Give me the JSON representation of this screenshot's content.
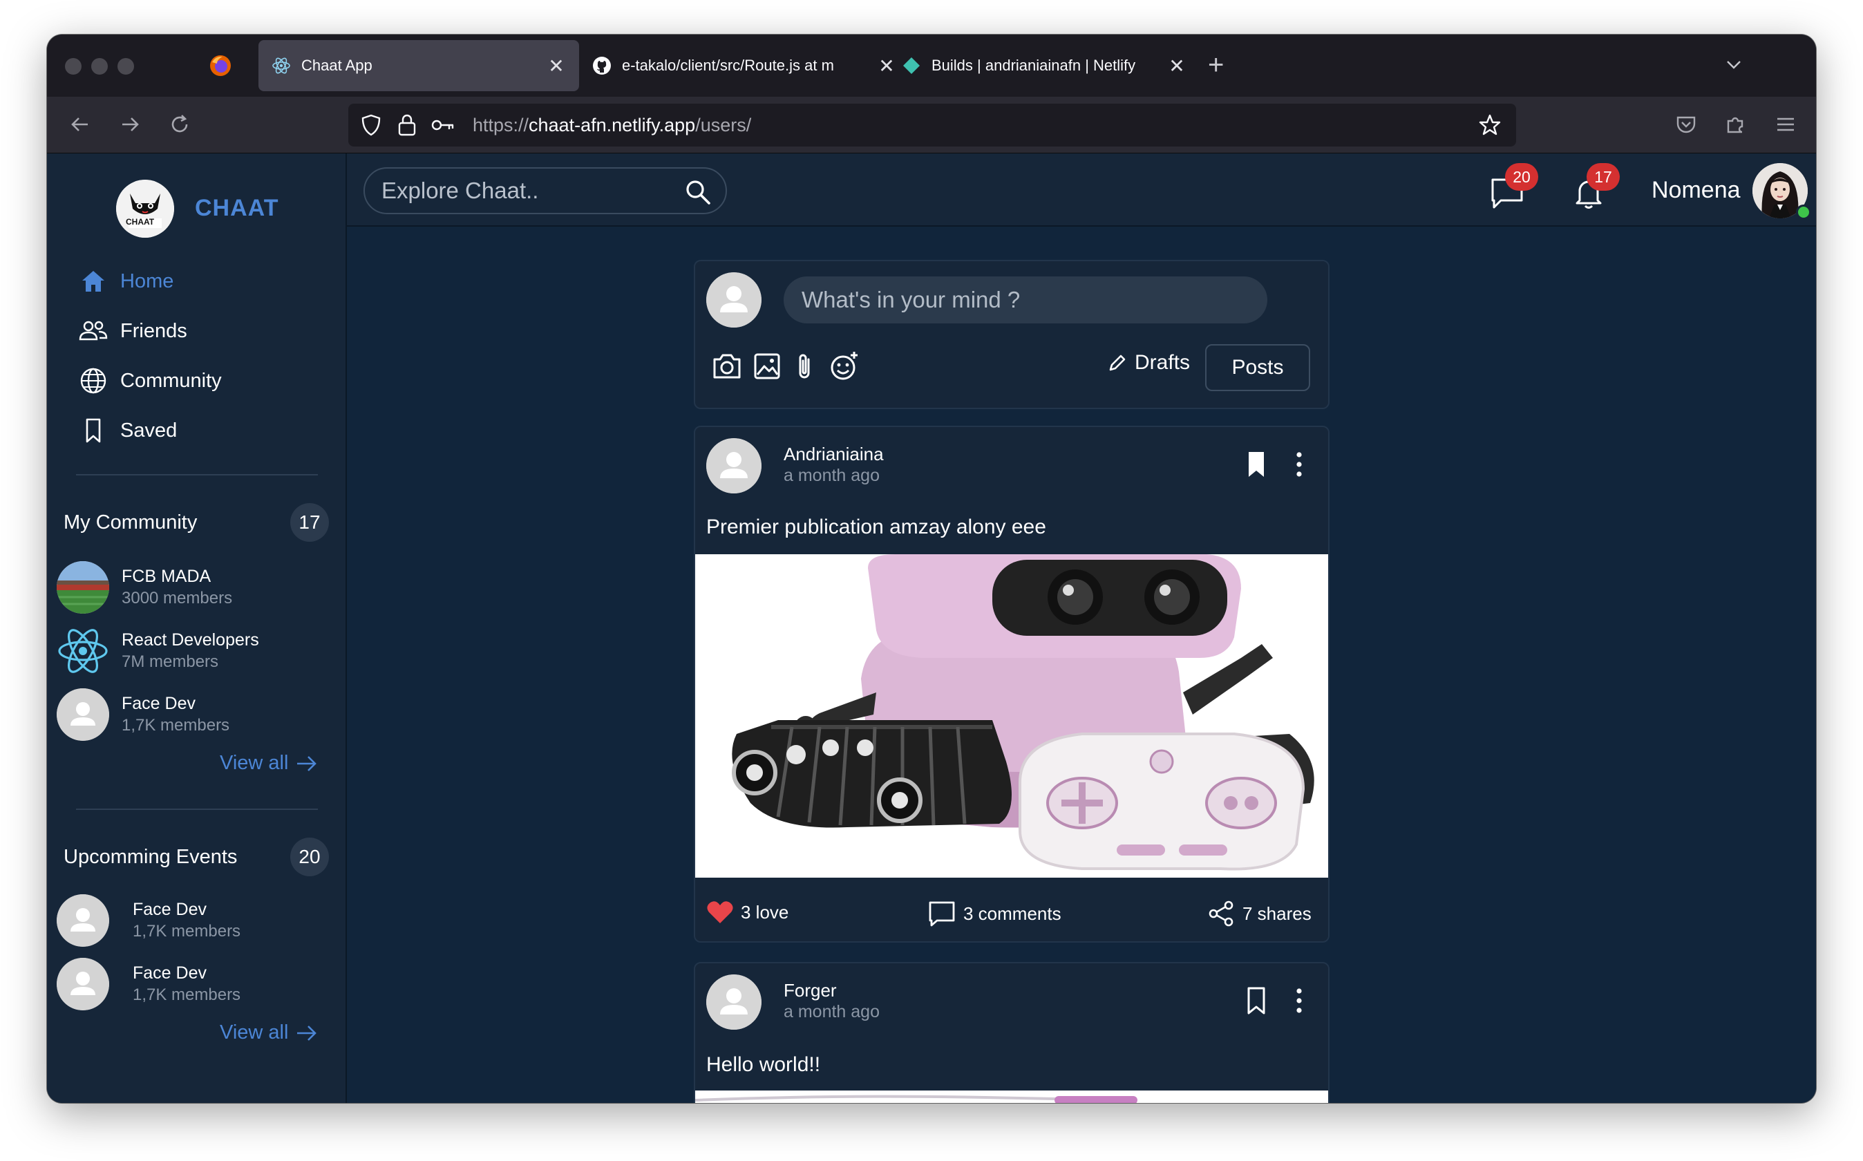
{
  "browser": {
    "tabs": [
      {
        "title": "Chaat App",
        "icon": "react-icon"
      },
      {
        "title": "e-takalo/client/src/Route.js at m",
        "icon": "github-icon"
      },
      {
        "title": "Builds | andrianiainafn | Netlify",
        "icon": "netlify-icon"
      }
    ],
    "url": {
      "scheme": "https://",
      "host": "chaat-afn.netlify.app",
      "path": "/users/"
    }
  },
  "app": {
    "brand": "CHAAT",
    "logo_caption": "CHAAT",
    "nav": [
      {
        "label": "Home",
        "icon": "home-icon",
        "active": true
      },
      {
        "label": "Friends",
        "icon": "friends-icon"
      },
      {
        "label": "Community",
        "icon": "globe-icon"
      },
      {
        "label": "Saved",
        "icon": "bookmark-icon"
      }
    ],
    "my_community": {
      "title": "My Community",
      "count": "17",
      "items": [
        {
          "name": "FCB MADA",
          "sub": "3000 members"
        },
        {
          "name": "React Developers",
          "sub": "7M members"
        },
        {
          "name": "Face Dev",
          "sub": "1,7K members"
        }
      ],
      "view_all": "View all"
    },
    "events": {
      "title": "Upcomming Events",
      "count": "20",
      "items": [
        {
          "name": "Face Dev",
          "sub": "1,7K members"
        },
        {
          "name": "Face Dev",
          "sub": "1,7K members"
        }
      ],
      "view_all": "View all"
    },
    "header": {
      "search_placeholder": "Explore Chaat..",
      "messages_count": "20",
      "notifications_count": "17",
      "user_name": "Nomena"
    },
    "composer": {
      "placeholder": "What's in your mind ?",
      "drafts_label": "Drafts",
      "posts_label": "Posts"
    },
    "posts": [
      {
        "author": "Andrianiaina",
        "time": "a month ago",
        "text": "Premier publication amzay alony eee",
        "love": "3 love",
        "comments": "3 comments",
        "shares": "7 shares"
      },
      {
        "author": "Forger",
        "time": "a month ago",
        "text": "Hello world!!"
      }
    ]
  },
  "colors": {
    "accent": "#4c86d6",
    "badge": "#d43030",
    "bg": "#11253b",
    "panel": "#162639",
    "love": "#e8454a"
  }
}
